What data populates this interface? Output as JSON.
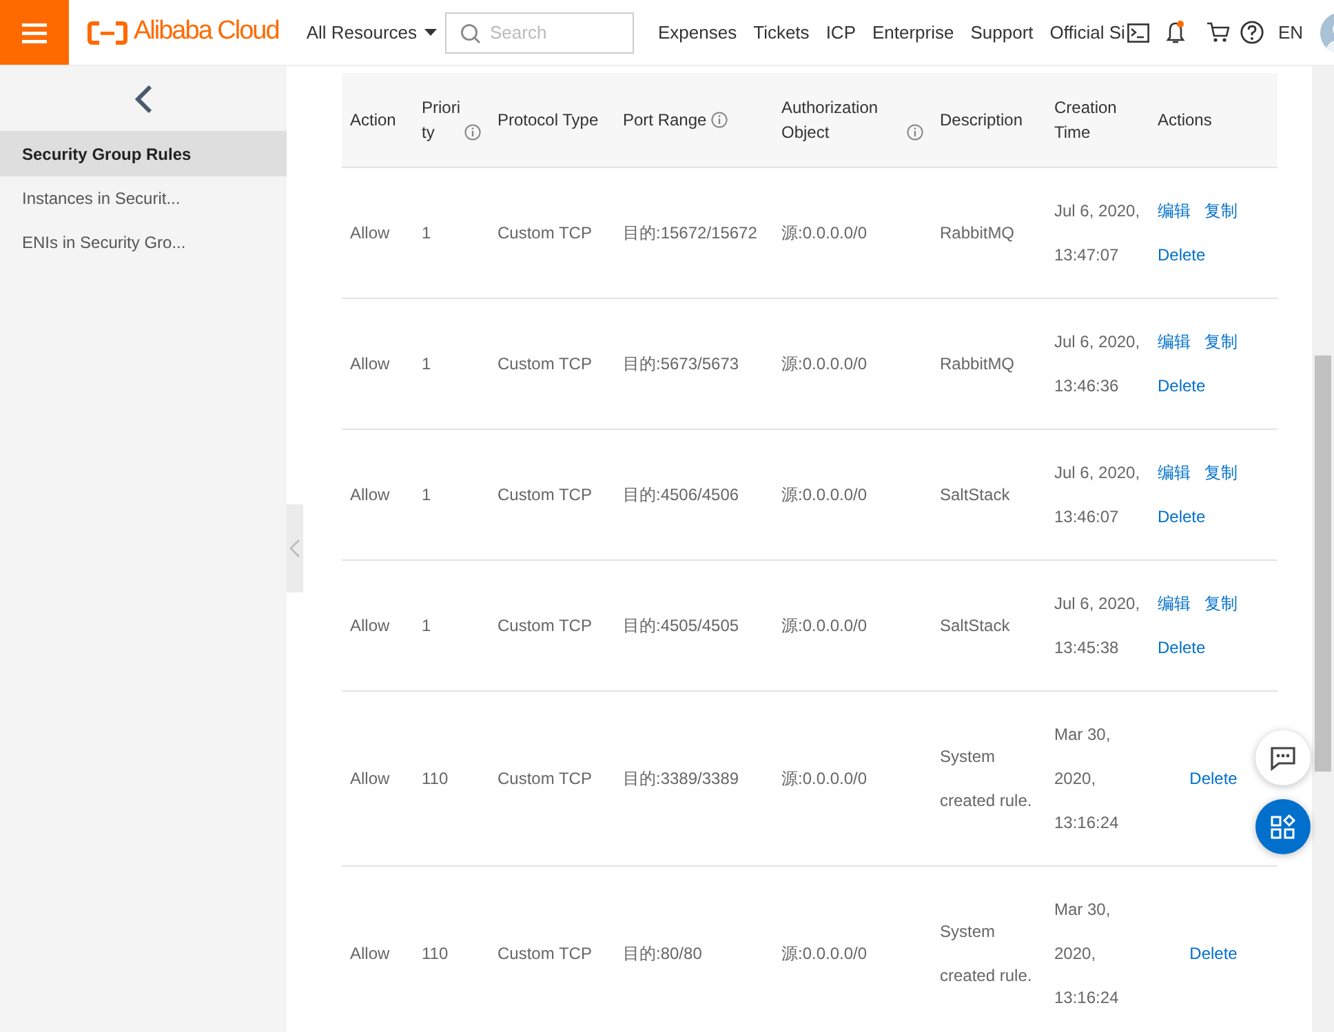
{
  "topbar": {
    "brand": "Alibaba Cloud",
    "resources": "All Resources",
    "search": {
      "placeholder": "Search"
    },
    "links": [
      "Expenses",
      "Tickets",
      "ICP",
      "Enterprise",
      "Support",
      "Official Si"
    ],
    "notification_dot": true,
    "language": "EN"
  },
  "sidebar": {
    "items": [
      {
        "label": "Security Group Rules",
        "selected": true
      },
      {
        "label": "Instances in Securit...",
        "selected": false
      },
      {
        "label": "ENIs in Security Gro...",
        "selected": false
      }
    ]
  },
  "table": {
    "columns": [
      {
        "label": "Action",
        "info": false
      },
      {
        "label": "Priority",
        "info": true
      },
      {
        "label": "Protocol Type",
        "info": false
      },
      {
        "label": "Port Range",
        "info": true
      },
      {
        "label": "Authorization Object",
        "info": true
      },
      {
        "label": "Description",
        "info": false
      },
      {
        "label": "Creation Time",
        "info": false
      },
      {
        "label": "Actions",
        "info": false
      }
    ],
    "rows": [
      {
        "action": "Allow",
        "priority": "1",
        "protocol": "Custom TCP",
        "port_range": "目的:15672/15672",
        "auth_object": "源:0.0.0.0/0",
        "description": [
          "RabbitMQ"
        ],
        "creation_time": [
          "Jul 6, 2020,",
          "13:47:07"
        ],
        "links": [
          "编辑",
          "复制"
        ],
        "delete": "Delete"
      },
      {
        "action": "Allow",
        "priority": "1",
        "protocol": "Custom TCP",
        "port_range": "目的:5673/5673",
        "auth_object": "源:0.0.0.0/0",
        "description": [
          "RabbitMQ"
        ],
        "creation_time": [
          "Jul 6, 2020,",
          "13:46:36"
        ],
        "links": [
          "编辑",
          "复制"
        ],
        "delete": "Delete"
      },
      {
        "action": "Allow",
        "priority": "1",
        "protocol": "Custom TCP",
        "port_range": "目的:4506/4506",
        "auth_object": "源:0.0.0.0/0",
        "description": [
          "SaltStack"
        ],
        "creation_time": [
          "Jul 6, 2020,",
          "13:46:07"
        ],
        "links": [
          "编辑",
          "复制"
        ],
        "delete": "Delete"
      },
      {
        "action": "Allow",
        "priority": "1",
        "protocol": "Custom TCP",
        "port_range": "目的:4505/4505",
        "auth_object": "源:0.0.0.0/0",
        "description": [
          "SaltStack"
        ],
        "creation_time": [
          "Jul 6, 2020,",
          "13:45:38"
        ],
        "links": [
          "编辑",
          "复制"
        ],
        "delete": "Delete"
      },
      {
        "action": "Allow",
        "priority": "110",
        "protocol": "Custom TCP",
        "port_range": "目的:3389/3389",
        "auth_object": "源:0.0.0.0/0",
        "description": [
          "System",
          "created rule."
        ],
        "creation_time": [
          "Mar 30,",
          "2020,",
          "13:16:24"
        ],
        "delete": "Delete"
      },
      {
        "action": "Allow",
        "priority": "110",
        "protocol": "Custom TCP",
        "port_range": "目的:80/80",
        "auth_object": "源:0.0.0.0/0",
        "description": [
          "System",
          "created rule."
        ],
        "creation_time": [
          "Mar 30,",
          "2020,",
          "13:16:24"
        ],
        "delete": "Delete"
      }
    ]
  }
}
